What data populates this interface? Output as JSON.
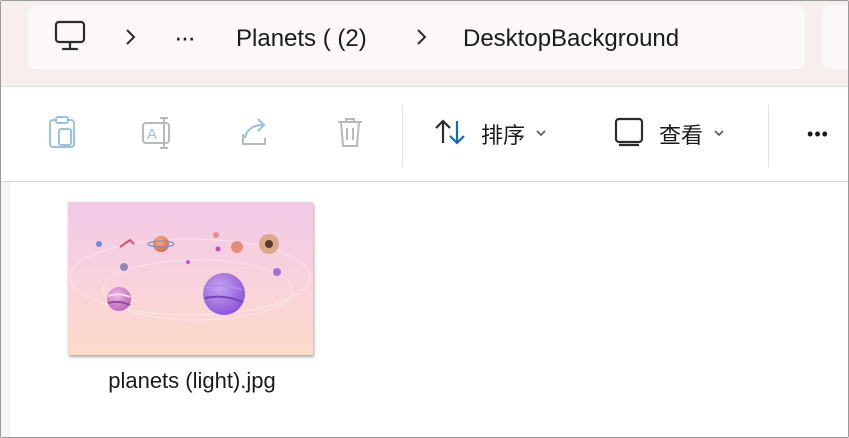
{
  "address_bar": {
    "crumbs": [
      "Planets ( (2)",
      "DesktopBackground"
    ],
    "overflow_label": "···"
  },
  "toolbar": {
    "sort_label": "排序",
    "view_label": "查看",
    "more_label": "•••"
  },
  "files": [
    {
      "name": "planets (light).jpg"
    }
  ],
  "colors": {
    "accent": "#0f6cbd",
    "disabled_icon": "#9cc3e0"
  }
}
